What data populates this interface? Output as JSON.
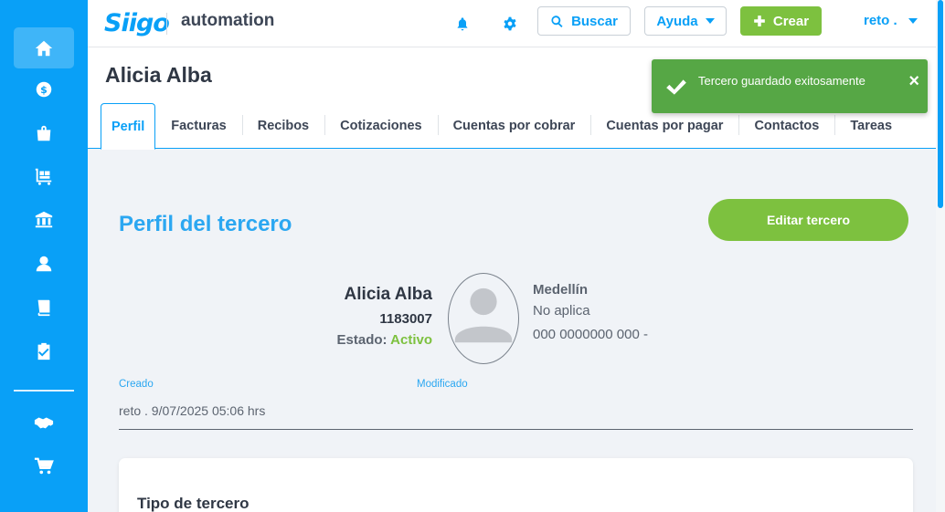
{
  "colors": {
    "brand": "#09a0f7",
    "accent_green": "#7dc13f",
    "toast_green": "#56a745",
    "title_blue": "#2ba7f1"
  },
  "sidebar": {
    "items": [
      {
        "icon": "home-icon",
        "active": true
      },
      {
        "icon": "money-icon"
      },
      {
        "icon": "shopping-bag-icon"
      },
      {
        "icon": "inventory-cart-icon"
      },
      {
        "icon": "bank-icon"
      },
      {
        "icon": "user-icon"
      },
      {
        "icon": "book-icon"
      },
      {
        "icon": "clipboard-check-icon"
      },
      {
        "icon": "handshake-icon"
      },
      {
        "icon": "shopping-cart-icon"
      }
    ]
  },
  "header": {
    "logo_text": "Siigo",
    "company": "automation",
    "search_label": "Buscar",
    "help_label": "Ayuda",
    "create_label": "Crear",
    "user_label": "reto ."
  },
  "page": {
    "title": "Alicia Alba",
    "tabs": [
      {
        "label": "Perfil",
        "active": true
      },
      {
        "label": "Facturas"
      },
      {
        "label": "Recibos"
      },
      {
        "label": "Cotizaciones"
      },
      {
        "label": "Cuentas por cobrar"
      },
      {
        "label": "Cuentas por pagar"
      },
      {
        "label": "Contactos"
      },
      {
        "label": "Tareas"
      }
    ]
  },
  "toast": {
    "message": "Tercero guardado exitosamente",
    "close": "×"
  },
  "profile": {
    "section_title": "Perfil del tercero",
    "edit_label": "Editar tercero",
    "name": "Alicia Alba",
    "id_number": "1183007",
    "status_label": "Estado:",
    "status_value": "Activo",
    "city": "Medellín",
    "secondary": "No aplica",
    "phone": "000 0000000 000 -",
    "created_label": "Creado",
    "modified_label": "Modificado",
    "created_value": "reto . 9/07/2025 05:06 hrs"
  },
  "card": {
    "title": "Tipo de tercero"
  }
}
